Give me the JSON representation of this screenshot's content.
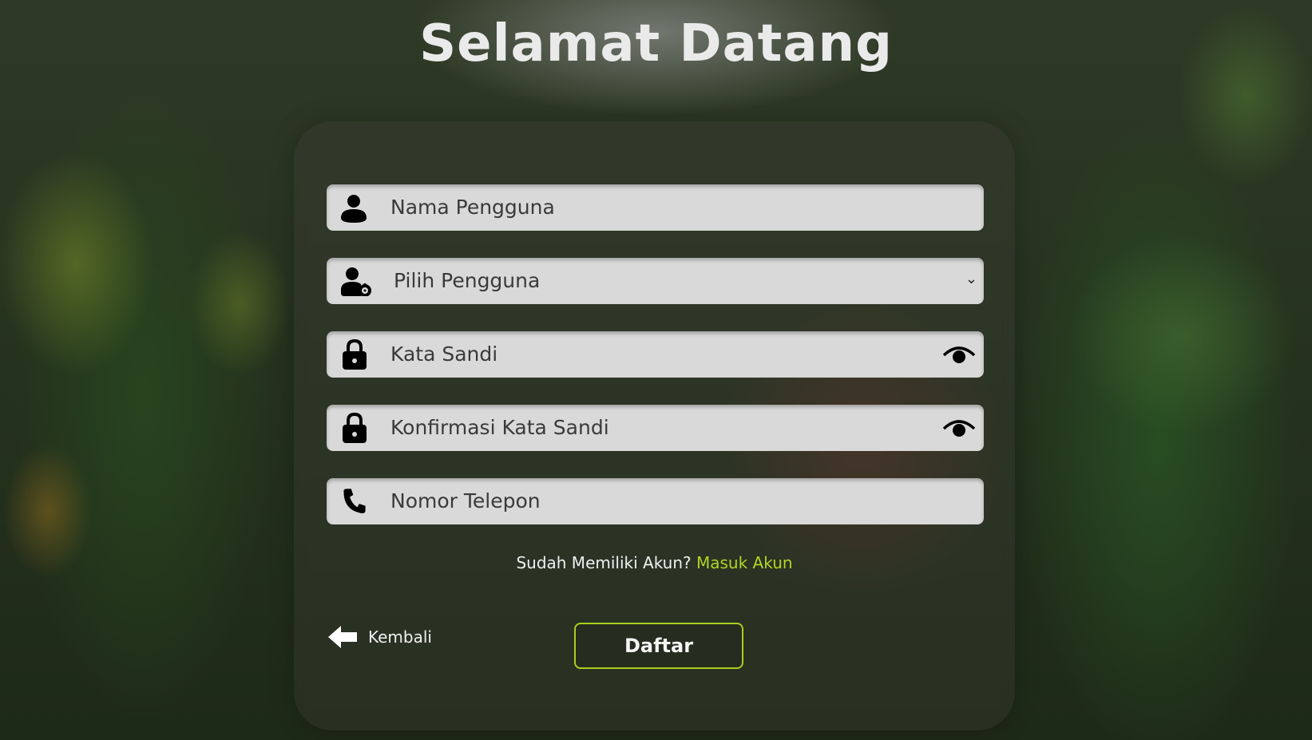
{
  "page": {
    "title": "Selamat Datang"
  },
  "form": {
    "username_placeholder": "Nama Pengguna",
    "role_select_value": "Pilih Pengguna",
    "password_placeholder": "Kata Sandi",
    "confirm_password_placeholder": "Konfirmasi Kata Sandi",
    "phone_placeholder": "Nomor Telepon"
  },
  "signin": {
    "question": "Sudah Memiliki Akun?",
    "link_label": "Masuk Akun"
  },
  "actions": {
    "back_label": "Kembali",
    "submit_label": "Daftar"
  },
  "icons": {
    "username": "user-icon",
    "role": "user-gear-icon",
    "password": "lock-icon",
    "confirm_password": "lock-icon",
    "phone": "phone-icon",
    "toggle_password": "eye-icon",
    "back": "arrow-left-icon"
  },
  "colors": {
    "accent": "#b5d424",
    "field_background": "#d9d9d9"
  }
}
